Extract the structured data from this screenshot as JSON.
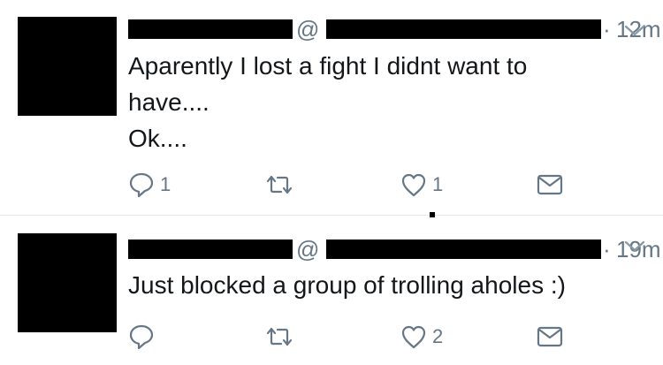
{
  "tweets": [
    {
      "handle_prefix": "@",
      "separator": "·",
      "time": "12m",
      "text_lines": [
        "Aparently I lost a fight I didnt want to",
        "have....",
        "Ok...."
      ],
      "reply_count": "1",
      "retweet_count": "",
      "like_count": "1"
    },
    {
      "handle_prefix": "@",
      "separator": "·",
      "time": "19m",
      "text_lines": [
        "Just blocked a group of trolling aholes :)"
      ],
      "reply_count": "",
      "retweet_count": "",
      "like_count": "2"
    }
  ],
  "icons": {
    "reply": "reply-icon",
    "retweet": "retweet-icon",
    "like": "heart-icon",
    "dm": "envelope-icon",
    "caret": "chevron-down-icon"
  },
  "colors": {
    "text": "#14171a",
    "muted": "#657786",
    "divider": "#e1e8ed",
    "redaction": "#000000"
  }
}
